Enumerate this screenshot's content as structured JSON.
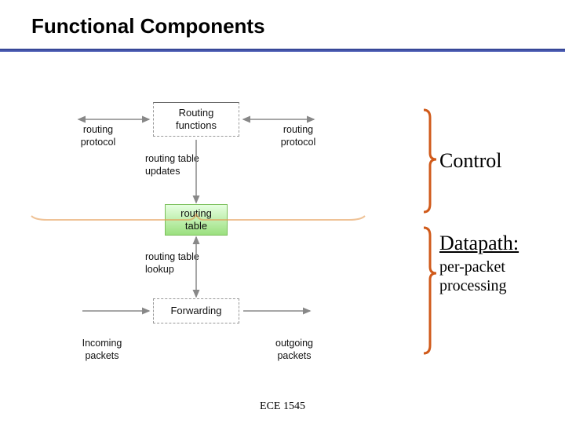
{
  "title": "Functional Components",
  "footer": "ECE 1545",
  "boxes": {
    "routing_functions": "Routing\nfunctions",
    "routing_table": "routing\ntable",
    "forwarding": "Forwarding"
  },
  "labels": {
    "routing_protocol_left": "routing\nprotocol",
    "routing_protocol_right": "routing\nprotocol",
    "routing_table_updates": "routing table\nupdates",
    "routing_table_lookup": "routing table\nlookup",
    "incoming_packets": "Incoming\npackets",
    "outgoing_packets": "outgoing\npackets"
  },
  "annotations": {
    "control": "Control",
    "datapath": "Datapath:",
    "datapath_sub": "per-packet\nprocessing"
  }
}
